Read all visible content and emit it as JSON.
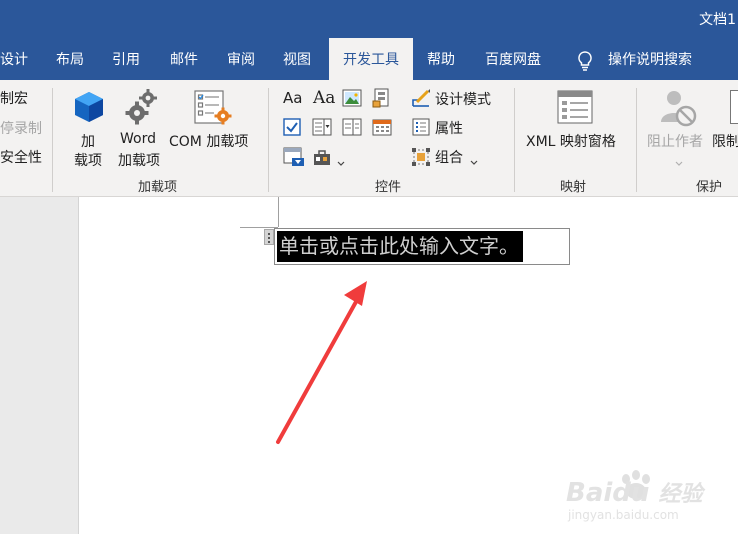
{
  "window": {
    "title": "文档1"
  },
  "tabs": [
    {
      "label": "设计",
      "active": false
    },
    {
      "label": "布局",
      "active": false
    },
    {
      "label": "引用",
      "active": false
    },
    {
      "label": "邮件",
      "active": false
    },
    {
      "label": "审阅",
      "active": false
    },
    {
      "label": "视图",
      "active": false
    },
    {
      "label": "开发工具",
      "active": true
    },
    {
      "label": "帮助",
      "active": false
    },
    {
      "label": "百度网盘",
      "active": false
    }
  ],
  "tell_me": {
    "label": "操作说明搜索"
  },
  "ribbon": {
    "code": {
      "macros": "制宏",
      "pause_recording": "停录制",
      "macro_security": "安全性"
    },
    "addins": {
      "label": "加载项",
      "addins_line1": "加",
      "addins_line2": "载项",
      "word_line1": "Word",
      "word_line2": "加载项",
      "com": "COM 加载项"
    },
    "controls": {
      "label": "控件",
      "aa1": "Aa",
      "aa2": "Aa",
      "design_mode": "设计模式",
      "properties": "属性",
      "group": "组合"
    },
    "mapping": {
      "label": "映射",
      "xml": "XML 映射窗格"
    },
    "protect": {
      "label": "保护",
      "block_authors": "阻止作者",
      "restrict": "限制"
    }
  },
  "document": {
    "placeholder": "单击或点击此处输入文字。"
  },
  "watermark": {
    "brand": "Baidu",
    "product": "经验",
    "url": "jingyan.baidu.com"
  },
  "colors": {
    "accent": "#2b579a",
    "arrow": "#f03c3c"
  }
}
